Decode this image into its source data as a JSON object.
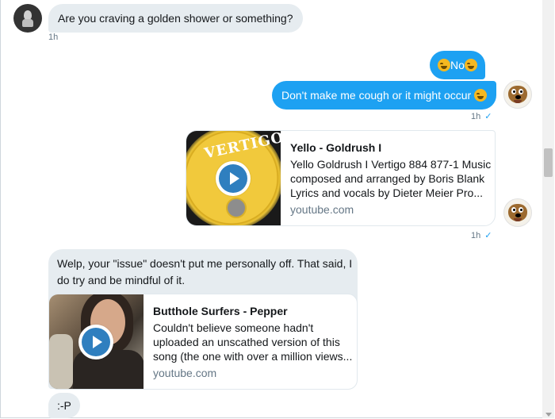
{
  "messages": {
    "m1": {
      "text": "Are you craving a golden shower or something?",
      "time": "1h"
    },
    "m2": {
      "text": "No"
    },
    "m3": {
      "text": "Don't make me cough or it might occur",
      "time": "1h",
      "check": "✓"
    },
    "m4": {
      "card_title": "Yello - Goldrush I",
      "card_desc_1": "Yello Goldrush I Vertigo 884 877-1 Music",
      "card_desc_2": "composed and arranged by Boris Blank",
      "card_desc_3": "Lyrics and vocals by Dieter Meier Pro...",
      "card_domain": "youtube.com",
      "thumb_text": "VERTIGO",
      "time": "1h",
      "check": "✓"
    },
    "m5": {
      "line_1": "Welp, your \"issue\" doesn't put me personally off. That said, I",
      "line_2": "do try and be mindful of it.",
      "card_title": "Butthole Surfers - Pepper",
      "card_desc_1": "Couldn't believe someone hadn't",
      "card_desc_2": "uploaded an unscathed version of this",
      "card_desc_3": "song (the one with over a million views...",
      "card_domain": "youtube.com"
    },
    "m6": {
      "text": ":-P"
    }
  },
  "icons": {
    "avatar_left": "user-avatar-icon",
    "avatar_right": "dog-avatar-icon",
    "emoji": "rofl-emoji-icon",
    "play": "play-button-icon",
    "check": "sent-checkmark-icon"
  },
  "colors": {
    "accent": "#1da1f2",
    "incoming_bubble": "#e6ecf0",
    "muted": "#657786"
  }
}
